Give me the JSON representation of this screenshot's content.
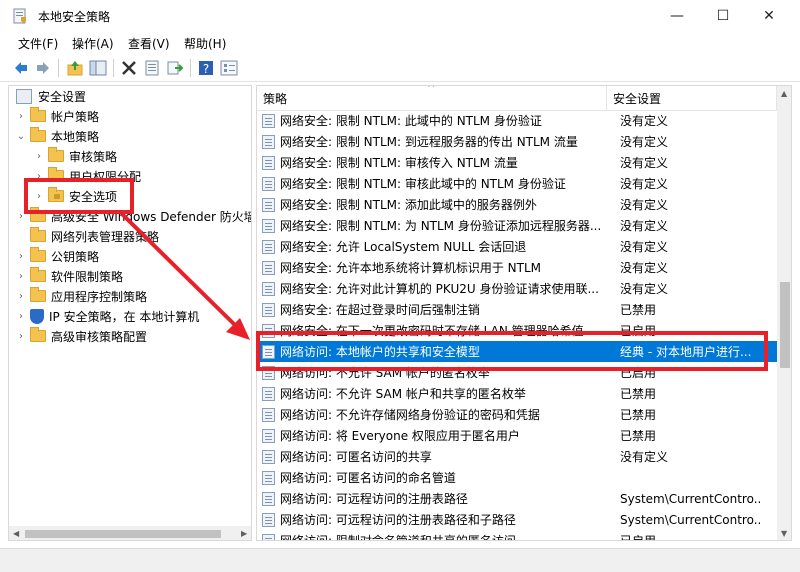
{
  "window": {
    "title": "本地安全策略",
    "minimize": "—",
    "maximize": "☐",
    "close": "✕"
  },
  "menu": [
    "文件(F)",
    "操作(A)",
    "查看(V)",
    "帮助(H)"
  ],
  "toolbar": [
    "back-icon",
    "forward-icon",
    "up-icon",
    "show-tree-icon",
    "delete-icon",
    "properties-icon",
    "export-icon",
    "help-icon",
    "view-icon"
  ],
  "tree": {
    "root": "安全设置",
    "items": [
      {
        "label": "帐户策略",
        "level": 1,
        "chevron": "›"
      },
      {
        "label": "本地策略",
        "level": 1,
        "chevron": "⌄"
      },
      {
        "label": "审核策略",
        "level": 2,
        "chevron": "›"
      },
      {
        "label": "用户权限分配",
        "level": 2,
        "chevron": "›"
      },
      {
        "label": "安全选项",
        "level": 2,
        "chevron": "›"
      },
      {
        "label": "高级安全 Windows Defender 防火墙",
        "level": 1,
        "chevron": "›"
      },
      {
        "label": "网络列表管理器策略",
        "level": 1,
        "chevron": ""
      },
      {
        "label": "公钥策略",
        "level": 1,
        "chevron": "›"
      },
      {
        "label": "软件限制策略",
        "level": 1,
        "chevron": "›"
      },
      {
        "label": "应用程序控制策略",
        "level": 1,
        "chevron": "›"
      },
      {
        "label": "IP 安全策略，在 本地计算机",
        "level": 1,
        "chevron": "›"
      },
      {
        "label": "高级审核策略配置",
        "level": 1,
        "chevron": "›"
      }
    ]
  },
  "list": {
    "columns": [
      "策略",
      "安全设置"
    ],
    "rows": [
      {
        "name": "网络安全: 限制 NTLM: 此域中的 NTLM 身份验证",
        "setting": "没有定义"
      },
      {
        "name": "网络安全: 限制 NTLM: 到远程服务器的传出 NTLM 流量",
        "setting": "没有定义"
      },
      {
        "name": "网络安全: 限制 NTLM: 审核传入 NTLM 流量",
        "setting": "没有定义"
      },
      {
        "name": "网络安全: 限制 NTLM: 审核此域中的 NTLM 身份验证",
        "setting": "没有定义"
      },
      {
        "name": "网络安全: 限制 NTLM: 添加此域中的服务器例外",
        "setting": "没有定义"
      },
      {
        "name": "网络安全: 限制 NTLM: 为 NTLM 身份验证添加远程服务器...",
        "setting": "没有定义"
      },
      {
        "name": "网络安全: 允许 LocalSystem NULL 会话回退",
        "setting": "没有定义"
      },
      {
        "name": "网络安全: 允许本地系统将计算机标识用于 NTLM",
        "setting": "没有定义"
      },
      {
        "name": "网络安全: 允许对此计算机的 PKU2U 身份验证请求使用联...",
        "setting": "没有定义"
      },
      {
        "name": "网络安全: 在超过登录时间后强制注销",
        "setting": "已禁用"
      },
      {
        "name": "网络安全: 在下一次更改密码时不存储 LAN 管理器哈希值",
        "setting": "已启用"
      },
      {
        "name": "网络访问: 本地帐户的共享和安全模型",
        "setting": "经典 - 对本地用户进行..."
      },
      {
        "name": "网络访问: 不允许 SAM 帐户的匿名枚举",
        "setting": "已启用"
      },
      {
        "name": "网络访问: 不允许 SAM 帐户和共享的匿名枚举",
        "setting": "已禁用"
      },
      {
        "name": "网络访问: 不允许存储网络身份验证的密码和凭据",
        "setting": "已禁用"
      },
      {
        "name": "网络访问: 将 Everyone 权限应用于匿名用户",
        "setting": "已禁用"
      },
      {
        "name": "网络访问: 可匿名访问的共享",
        "setting": "没有定义"
      },
      {
        "name": "网络访问: 可匿名访问的命名管道",
        "setting": ""
      },
      {
        "name": "网络访问: 可远程访问的注册表路径",
        "setting": "System\\CurrentContro..."
      },
      {
        "name": "网络访问: 可远程访问的注册表路径和子路径",
        "setting": "System\\CurrentContro..."
      },
      {
        "name": "网络访问: 限制对命名管道和共享的匿名访问",
        "setting": "已启用"
      }
    ],
    "selected_index": 11
  },
  "annotations": {
    "color": "#e8202a"
  }
}
